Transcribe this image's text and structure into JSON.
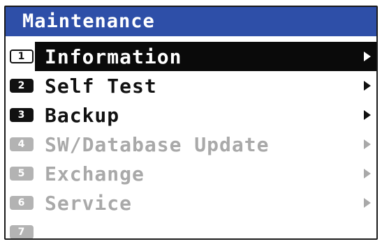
{
  "title": "Maintenance",
  "menu": {
    "items": [
      {
        "number": "1",
        "label": "Information",
        "state": "selected",
        "has_arrow": true
      },
      {
        "number": "2",
        "label": "Self Test",
        "state": "enabled",
        "has_arrow": true
      },
      {
        "number": "3",
        "label": "Backup",
        "state": "enabled",
        "has_arrow": true
      },
      {
        "number": "4",
        "label": "SW/Database Update",
        "state": "disabled",
        "has_arrow": true
      },
      {
        "number": "5",
        "label": "Exchange",
        "state": "disabled",
        "has_arrow": true
      },
      {
        "number": "6",
        "label": "Service",
        "state": "disabled",
        "has_arrow": true
      },
      {
        "number": "7",
        "label": "",
        "state": "disabled",
        "has_arrow": false
      }
    ]
  },
  "colors": {
    "title_bar": "#2e4fa8",
    "selected_bg": "#0a0a0a",
    "enabled_text": "#111111",
    "disabled_text": "#a9a9a9"
  },
  "icons": {
    "submenu": "chevron-right-icon"
  }
}
